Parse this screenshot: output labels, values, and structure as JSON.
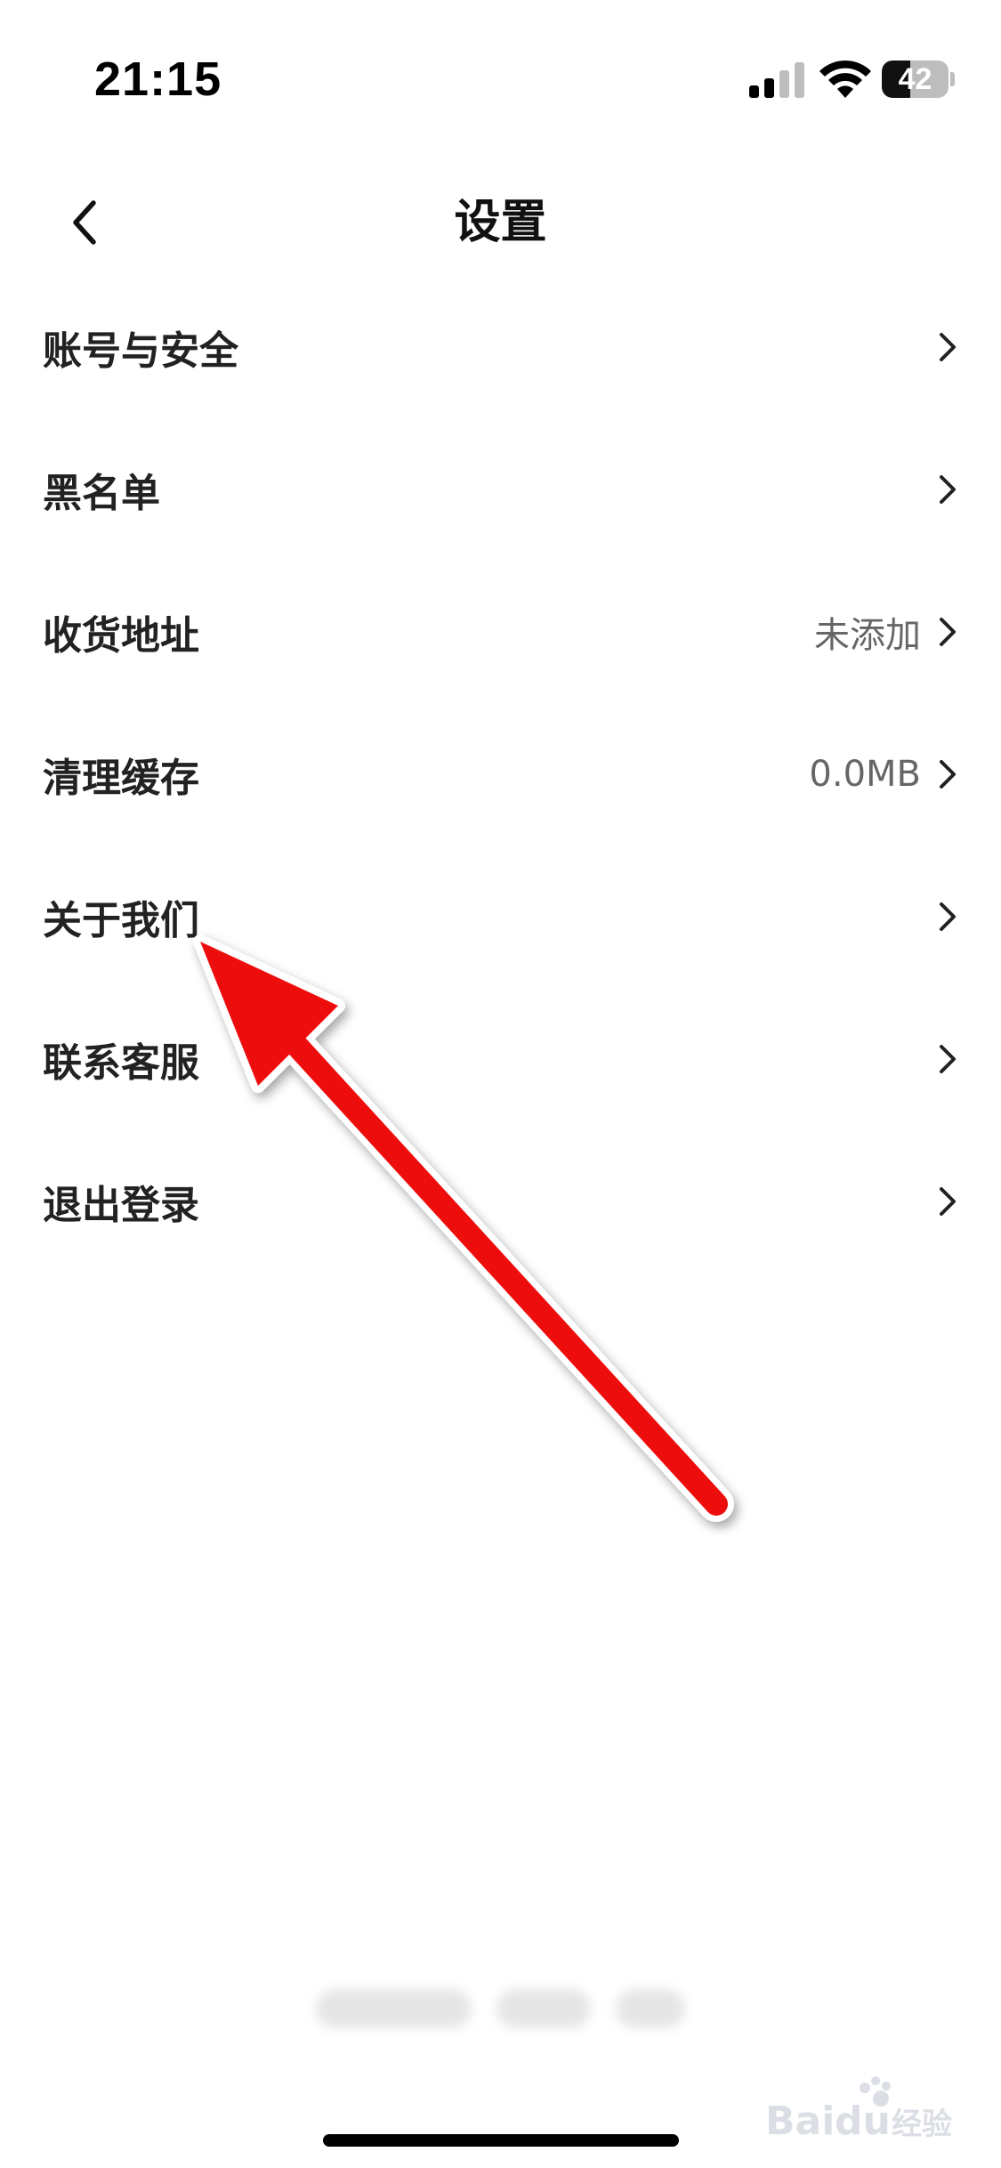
{
  "status_bar": {
    "time": "21:15",
    "battery_level": "42",
    "battery_fraction": 0.42,
    "icons": [
      "signal-icon",
      "wifi-icon",
      "battery-icon"
    ]
  },
  "nav": {
    "title": "设置",
    "back_icon": "chevron-left-icon"
  },
  "settings": {
    "items": [
      {
        "label": "账号与安全",
        "value": ""
      },
      {
        "label": "黑名单",
        "value": ""
      },
      {
        "label": "收货地址",
        "value": "未添加"
      },
      {
        "label": "清理缓存",
        "value": "0.0MB"
      },
      {
        "label": "关于我们",
        "value": ""
      },
      {
        "label": "联系客服",
        "value": ""
      },
      {
        "label": "退出登录",
        "value": ""
      }
    ]
  },
  "annotation": {
    "color": "#ee1111",
    "pointing_to": "关于我们"
  },
  "watermark": {
    "text": "Baidu经验"
  },
  "colors": {
    "text_primary": "#222222",
    "text_secondary": "#666666",
    "background": "#ffffff"
  }
}
